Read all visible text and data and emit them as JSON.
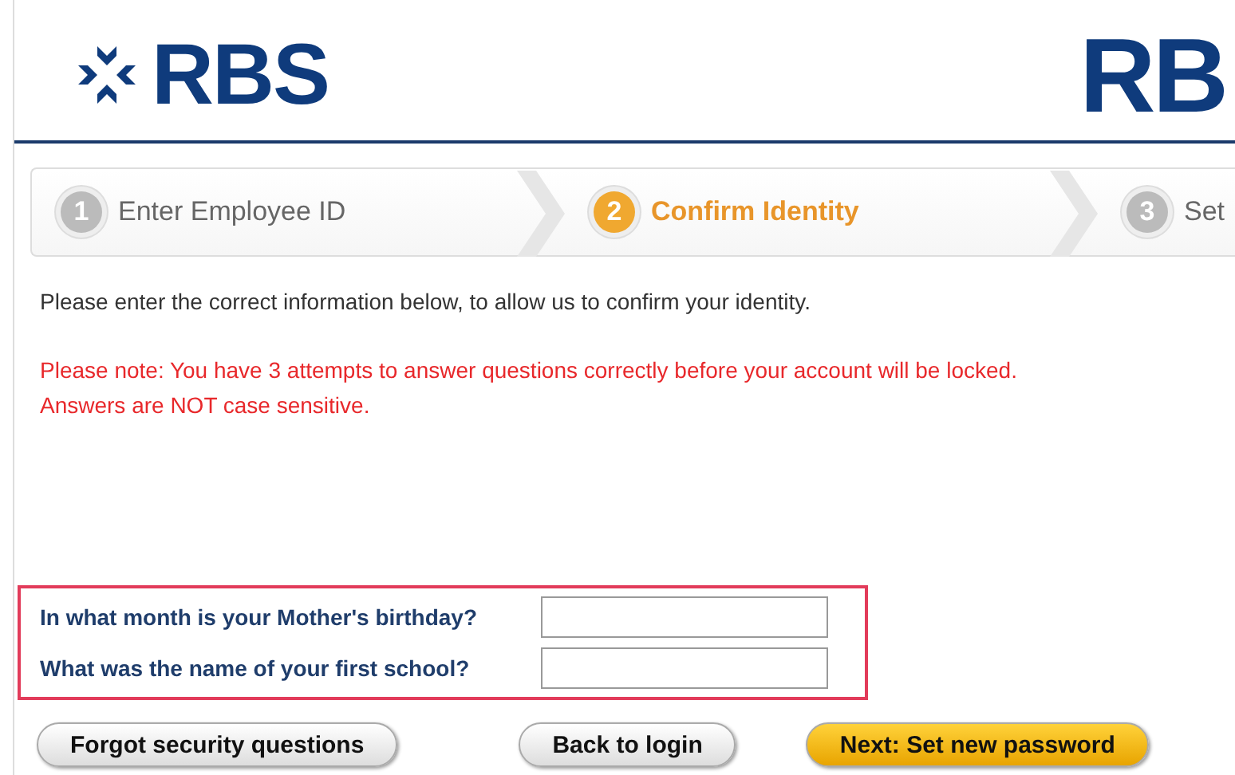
{
  "header": {
    "logo_text": "RBS",
    "right_logo_text": "RB"
  },
  "steps": [
    {
      "number": "1",
      "label": "Enter Employee ID",
      "selected": false
    },
    {
      "number": "2",
      "label": "Confirm Identity",
      "selected": true
    },
    {
      "number": "3",
      "label": "Set",
      "selected": false
    }
  ],
  "intro": "Please enter the correct information below, to allow us to confirm your identity.",
  "notes": [
    "Please note: You have 3 attempts to answer questions correctly before your account will be locked.",
    "Answers are NOT case sensitive."
  ],
  "questions": [
    {
      "label": "In what month is your Mother's birthday?"
    },
    {
      "label": "What was the name of your first school?"
    }
  ],
  "buttons": [
    {
      "label": "Forgot security questions",
      "kind": "secondary"
    },
    {
      "label": "Back to login",
      "kind": "secondary"
    },
    {
      "label": "Next: Set new password",
      "kind": "primary"
    }
  ]
}
